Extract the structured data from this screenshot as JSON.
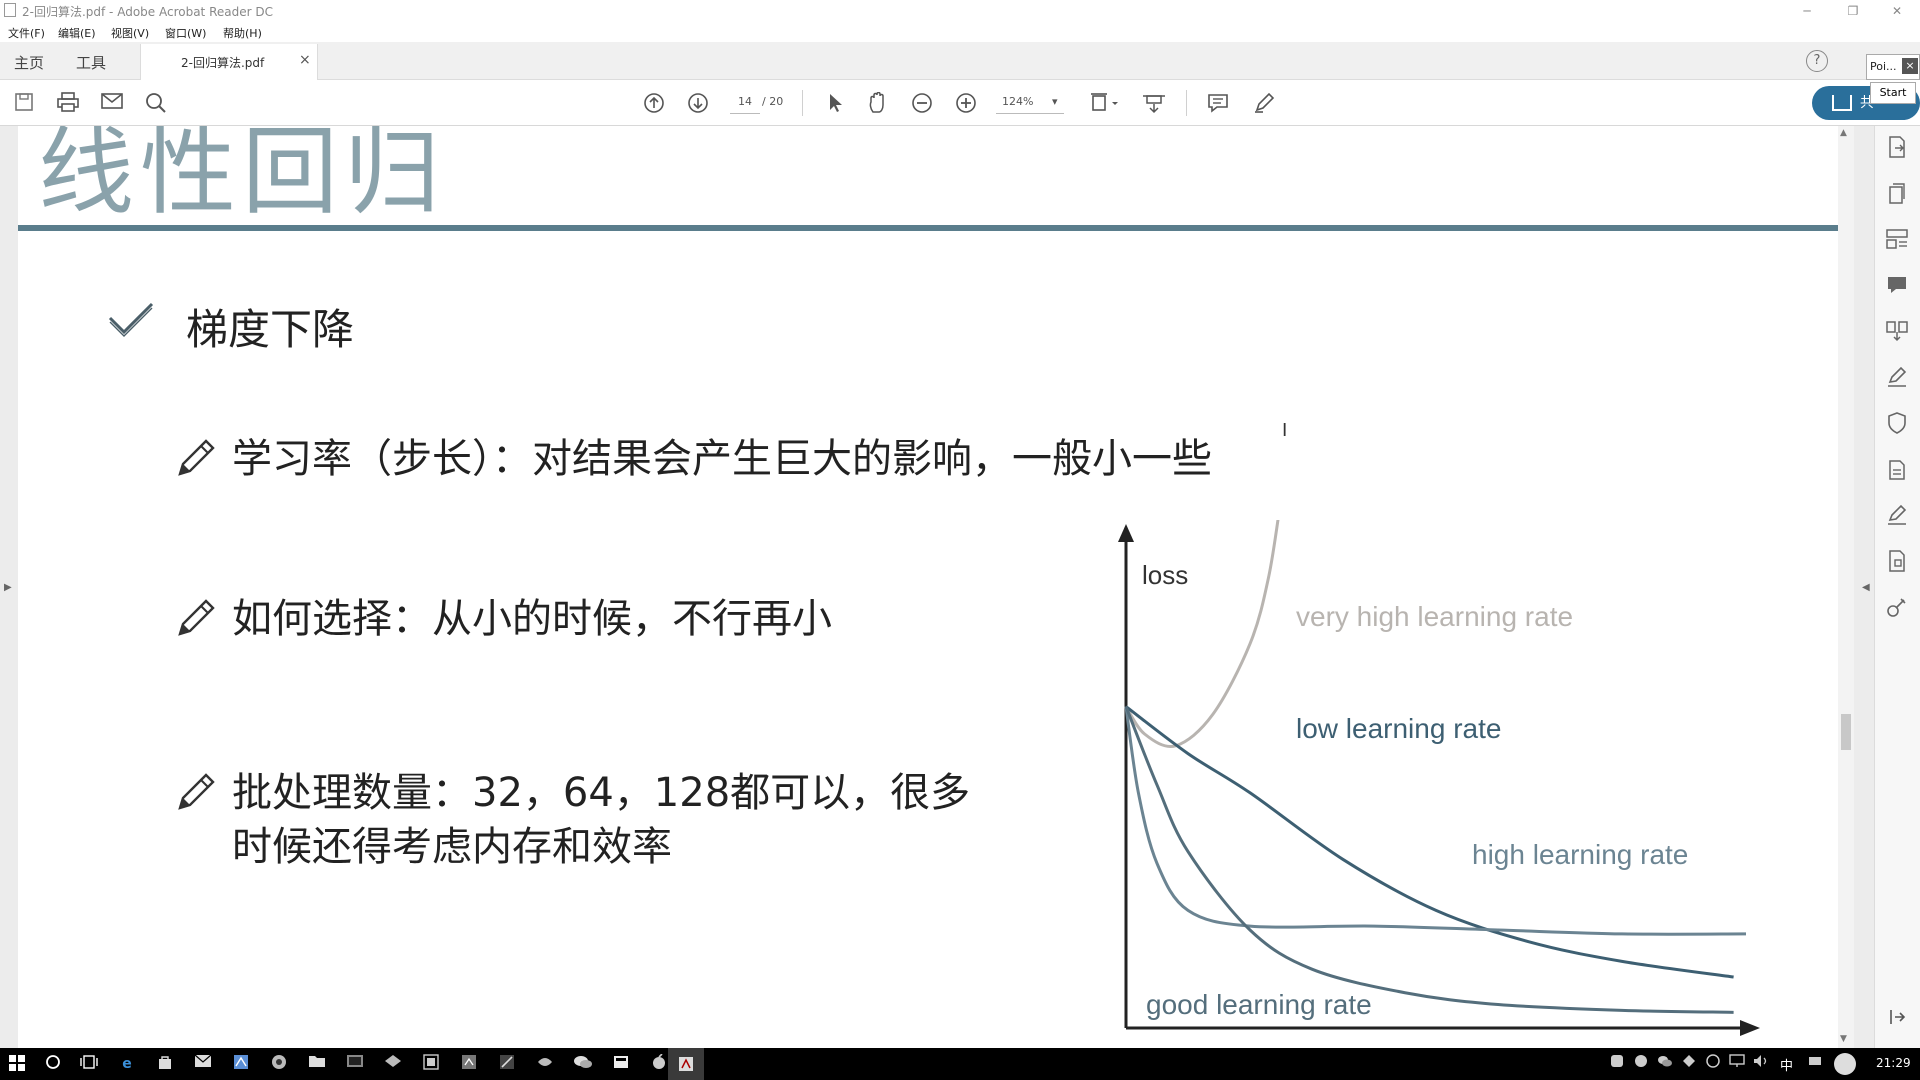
{
  "window": {
    "title": "2-回归算法.pdf - Adobe Acrobat Reader DC",
    "controls": [
      "─",
      "❐",
      "✕"
    ]
  },
  "menu": [
    "文件(F)",
    "编辑(E)",
    "视图(V)",
    "窗口(W)",
    "帮助(H)"
  ],
  "tabs": {
    "home": "主页",
    "tools": "工具",
    "document": "2-回归算法.pdf",
    "close": "×",
    "help": "?"
  },
  "toolbar": {
    "page_current": "14",
    "page_total": "/ 20",
    "zoom": "124%",
    "zoom_arrow": "▾"
  },
  "share_button": "共",
  "popup": {
    "label": "Poi...",
    "close": "×",
    "start": "Start"
  },
  "slide": {
    "title": "线性回归",
    "heading": "梯度下降",
    "bullets": [
      "学习率（步长）：对结果会产生巨大的影响，一般小一些",
      "如何选择：从小的时候，不行再小",
      "批处理数量：32，64，128都可以，很多",
      "时候还得考虑内存和效率"
    ]
  },
  "chart_data": {
    "type": "line",
    "ylabel": "loss",
    "xlabel": "",
    "series": [
      {
        "name": "very high learning rate",
        "color": "#b8b4b0",
        "x": [
          0,
          0.03,
          0.08,
          0.14,
          0.2,
          0.23,
          0.25
        ],
        "y": [
          0.82,
          0.75,
          0.72,
          0.8,
          0.98,
          1.15,
          1.35
        ]
      },
      {
        "name": "low learning rate",
        "color": "#3d5f72",
        "x": [
          0,
          0.1,
          0.2,
          0.35,
          0.5,
          0.65,
          0.8,
          0.98
        ],
        "y": [
          0.82,
          0.7,
          0.6,
          0.43,
          0.3,
          0.22,
          0.17,
          0.13
        ]
      },
      {
        "name": "high learning rate",
        "color": "#6b8492",
        "x": [
          0,
          0.02,
          0.05,
          0.1,
          0.2,
          0.4,
          0.6,
          0.8,
          1.0
        ],
        "y": [
          0.82,
          0.6,
          0.42,
          0.3,
          0.26,
          0.26,
          0.25,
          0.24,
          0.24
        ]
      },
      {
        "name": "good learning rate",
        "color": "#546e7c",
        "x": [
          0,
          0.05,
          0.1,
          0.2,
          0.3,
          0.45,
          0.6,
          0.8,
          0.98
        ],
        "y": [
          0.82,
          0.62,
          0.45,
          0.25,
          0.15,
          0.09,
          0.06,
          0.045,
          0.04
        ]
      }
    ],
    "grid": false,
    "legend": "none"
  },
  "right_panel_icons": [
    "export-pdf-icon",
    "create-pdf-icon",
    "organize-pages-icon",
    "comment-icon",
    "combine-files-icon",
    "fill-sign-icon",
    "protect-icon",
    "send-for-review-icon",
    "edit-pdf-icon",
    "compress-icon",
    "more-tools-icon"
  ],
  "taskbar": {
    "clock": "21:29",
    "ime": "中"
  }
}
